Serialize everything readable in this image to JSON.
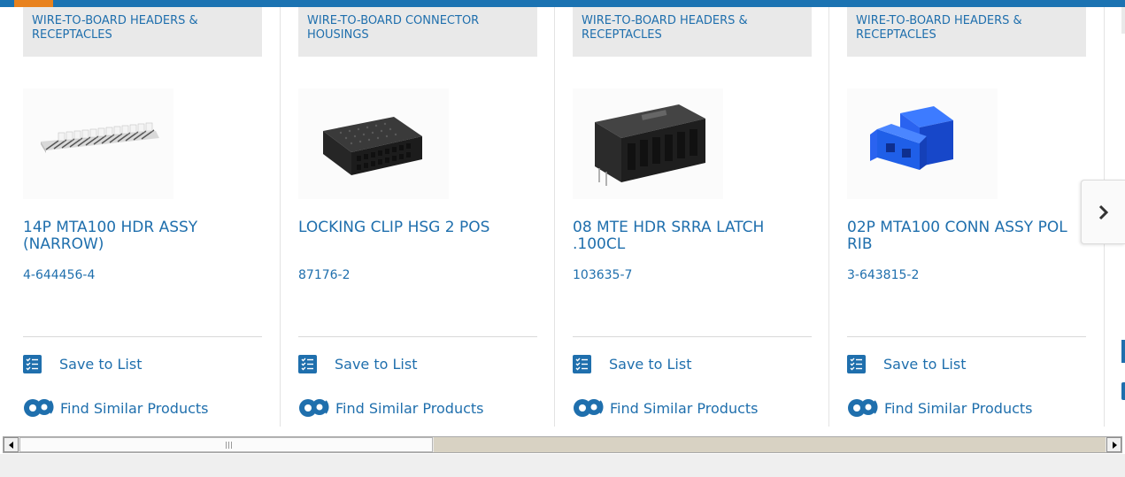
{
  "products": [
    {
      "category": "WIRE-TO-BOARD HEADERS & RECEPTACLES",
      "image_icon": "pin-header-strip",
      "title": "14P MTA100 HDR ASSY (NARROW)",
      "part_number": "4-644456-4"
    },
    {
      "category": "WIRE-TO-BOARD CONNECTOR HOUSINGS",
      "image_icon": "black-connector-housing",
      "title": "LOCKING CLIP HSG 2 POS",
      "part_number": "87176-2"
    },
    {
      "category": "WIRE-TO-BOARD HEADERS & RECEPTACLES",
      "image_icon": "right-angle-latch-header",
      "title": "08 MTE HDR SRRA LATCH .100CL",
      "part_number": "103635-7"
    },
    {
      "category": "WIRE-TO-BOARD HEADERS & RECEPTACLES",
      "image_icon": "blue-polarized-connector",
      "title": "02P MTA100 CONN ASSY POL RIB",
      "part_number": "3-643815-2"
    }
  ],
  "actions": {
    "save_label": "Save to List",
    "similar_label": "Find Similar Products"
  },
  "colors": {
    "link": "#1f6fad",
    "top_bar": "#1b73b2",
    "top_accent": "#e8821e",
    "category_bg": "#e9e9e9",
    "blue_connector": "#1f5fe8"
  },
  "icons": {
    "save": "checklist-icon",
    "similar": "gears-icon",
    "next": "chevron-right-icon",
    "scroll_left": "arrow-left-icon",
    "scroll_right": "arrow-right-icon"
  }
}
